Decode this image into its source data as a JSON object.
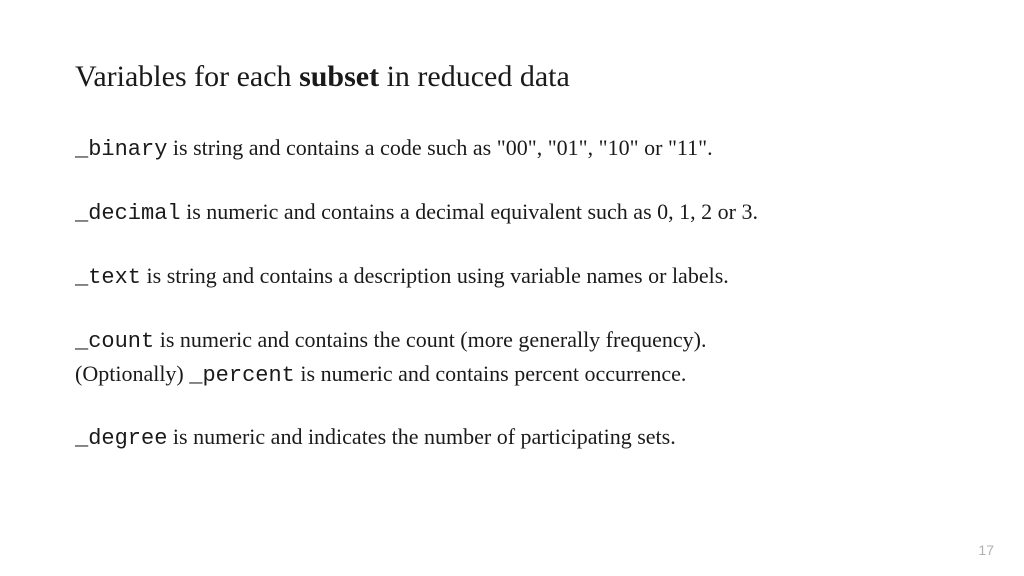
{
  "title": {
    "pre": "Variables for each ",
    "bold": "subset",
    "post": " in reduced data"
  },
  "entries": {
    "binary": {
      "name": "_binary",
      "desc": " is string and contains a code such as \"00\", \"01\", \"10\" or \"11\"."
    },
    "decimal": {
      "name": "_decimal",
      "desc": " is numeric and contains a decimal equivalent such as 0, 1, 2 or 3."
    },
    "text": {
      "name": "_text",
      "desc": " is string and contains a description using variable names or labels."
    },
    "count": {
      "name": "_count",
      "desc": " is numeric and contains the count (more generally frequency)."
    },
    "percent": {
      "pre": " (Optionally) ",
      "name": "_percent",
      "desc": " is numeric and contains percent occurrence."
    },
    "degree": {
      "name": "_degree",
      "desc": " is numeric and indicates the number of participating sets."
    }
  },
  "page_number": "17"
}
